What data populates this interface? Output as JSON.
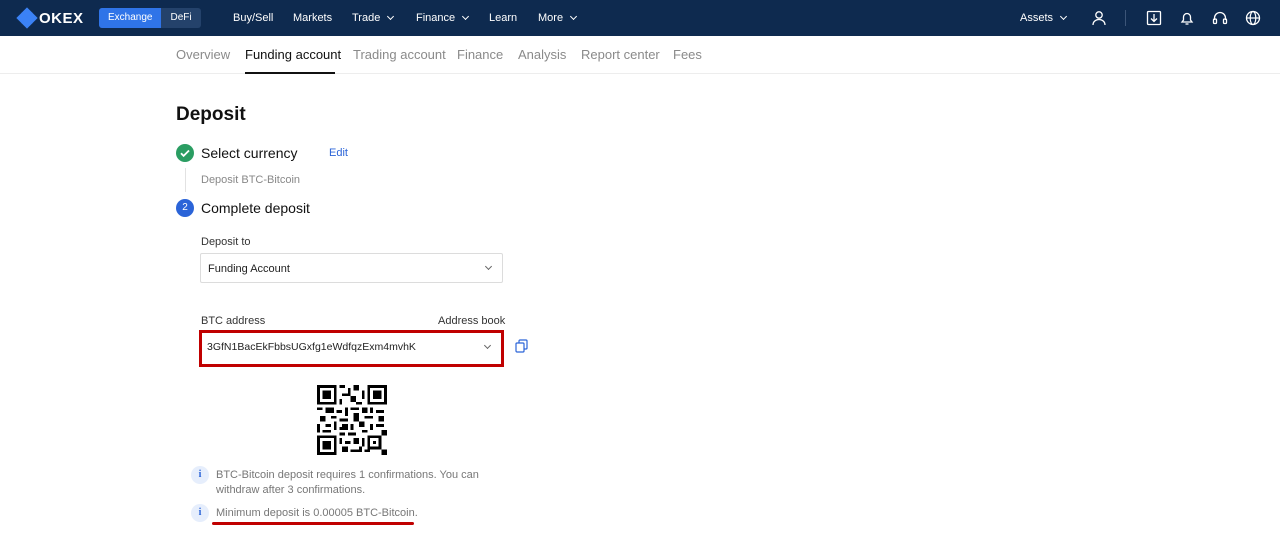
{
  "brand": {
    "name": "OKEX"
  },
  "mode_switch": {
    "exchange": "Exchange",
    "defi": "DeFi"
  },
  "nav": {
    "buy_sell": "Buy/Sell",
    "markets": "Markets",
    "trade": "Trade",
    "finance": "Finance",
    "learn": "Learn",
    "more": "More",
    "assets": "Assets"
  },
  "tabs": [
    "Overview",
    "Funding account",
    "Trading account",
    "Finance",
    "Analysis",
    "Report center",
    "Fees"
  ],
  "page": {
    "title": "Deposit",
    "step1": {
      "title": "Select currency",
      "edit": "Edit",
      "summary": "Deposit BTC-Bitcoin"
    },
    "step2": {
      "number": "2",
      "title": "Complete deposit"
    },
    "deposit_to": {
      "label": "Deposit to",
      "value": "Funding Account"
    },
    "address": {
      "label": "BTC address",
      "address_book": "Address book",
      "value": "3GfN1BacEkFbbsUGxfg1eWdfqzExm4mvhK"
    },
    "notes": [
      "BTC-Bitcoin deposit requires 1 confirmations. You can withdraw after 3 confirmations.",
      "Minimum deposit is 0.00005 BTC-Bitcoin."
    ]
  },
  "colors": {
    "topbar": "#0e2a4f",
    "accent": "#2b64d8",
    "success": "#2a9d62",
    "highlight": "#c00000"
  },
  "icons": [
    "user-icon",
    "download-icon",
    "bell-icon",
    "headset-icon",
    "globe-icon",
    "copy-icon",
    "qr-code",
    "info-icon",
    "check-icon"
  ]
}
